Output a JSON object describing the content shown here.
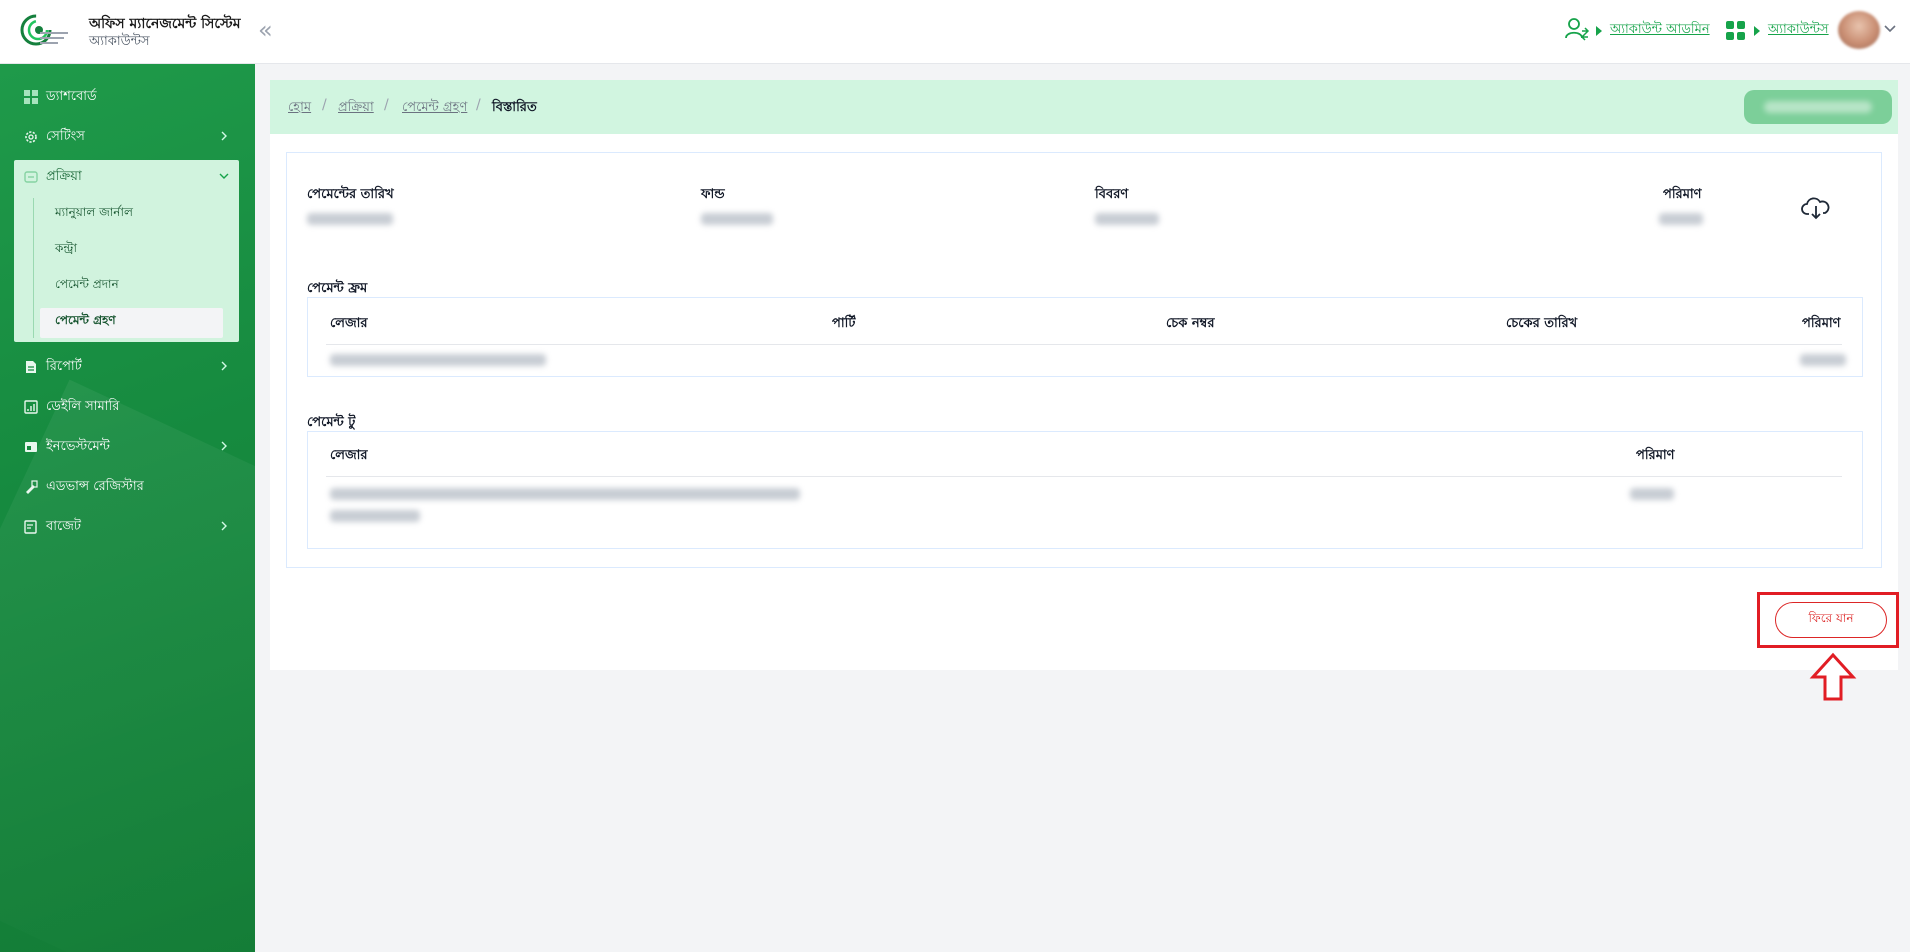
{
  "header": {
    "app_title": "অফিস ম্যানেজমেন্ট সিস্টেম",
    "app_subtitle": "অ্যাকাউন্টস",
    "role_link": "অ্যাকাউন্ট আডমিন",
    "module_link": "অ্যাকাউন্টস",
    "colors": {
      "accent": "#16a34a"
    }
  },
  "sidebar": {
    "items": [
      {
        "label": "ড্যাশবোর্ড",
        "icon": "dashboard-icon"
      },
      {
        "label": "সেটিংস",
        "icon": "gear-icon"
      },
      {
        "label": "প্রক্রিয়া",
        "icon": "process-icon"
      },
      {
        "label": "রিপোর্ট",
        "icon": "report-icon"
      },
      {
        "label": "ডেইলি সামারি",
        "icon": "summary-icon"
      },
      {
        "label": "ইনভেস্টমেন্ট",
        "icon": "investment-icon"
      },
      {
        "label": "এডভান্স রেজিস্টার",
        "icon": "register-icon"
      },
      {
        "label": "বাজেট",
        "icon": "budget-icon"
      }
    ],
    "sub_items": [
      {
        "label": "ম্যানুয়াল জার্নাল"
      },
      {
        "label": "কন্ট্রা"
      },
      {
        "label": "পেমেন্ট প্রদান"
      },
      {
        "label": "পেমেন্ট গ্রহণ"
      }
    ]
  },
  "breadcrumb": {
    "items": [
      "হোম",
      "প্রক্রিয়া",
      "পেমেন্ট গ্রহণ"
    ],
    "current": "বিস্তারিত",
    "separator": "/"
  },
  "summary": {
    "labels": {
      "date": "পেমেন্টের তারিখ",
      "fund": "ফান্ড",
      "description": "বিবরণ",
      "amount": "পরিমাণ"
    }
  },
  "payment_from": {
    "title": "পেমেন্ট ফ্রম",
    "columns": [
      "লেজার",
      "পার্টি",
      "চেক নম্বর",
      "চেকের তারিখ",
      "পরিমাণ"
    ]
  },
  "payment_to": {
    "title": "পেমেন্ট টু",
    "columns": [
      "লেজার",
      "পরিমাণ"
    ]
  },
  "actions": {
    "back_label": "ফিরে যান"
  }
}
